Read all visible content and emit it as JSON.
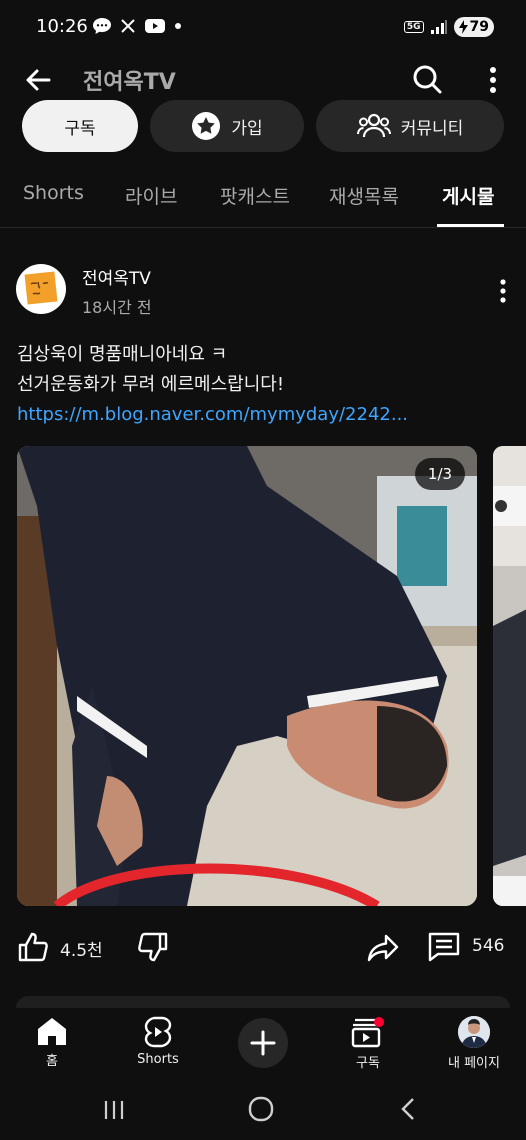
{
  "status": {
    "time": "10:26",
    "battery": "79",
    "network": "5G"
  },
  "header": {
    "title": "전여옥TV"
  },
  "actions": {
    "subscribe": "구독",
    "join": "가입",
    "community": "커뮤니티"
  },
  "tabs": [
    {
      "label": "Shorts"
    },
    {
      "label": "라이브"
    },
    {
      "label": "팟캐스트"
    },
    {
      "label": "재생목록"
    },
    {
      "label": "게시물"
    }
  ],
  "post": {
    "author": "전여옥TV",
    "time": "18시간 전",
    "text_line1": "김상욱이 명품매니아네요 ㅋ",
    "text_line2": "선거운동화가 무려 에르메스랍니다!",
    "link": "https://m.blog.naver.com/mymyday/2242...",
    "image_counter": "1/3",
    "likes": "4.5천",
    "comments": "546"
  },
  "bottom_nav": {
    "home": "홈",
    "shorts": "Shorts",
    "subscriptions": "구독",
    "you": "내 페이지"
  },
  "colors": {
    "background": "#0f0f0f",
    "link": "#3ea6ff",
    "chip": "#272727",
    "notification": "#ff0033"
  }
}
